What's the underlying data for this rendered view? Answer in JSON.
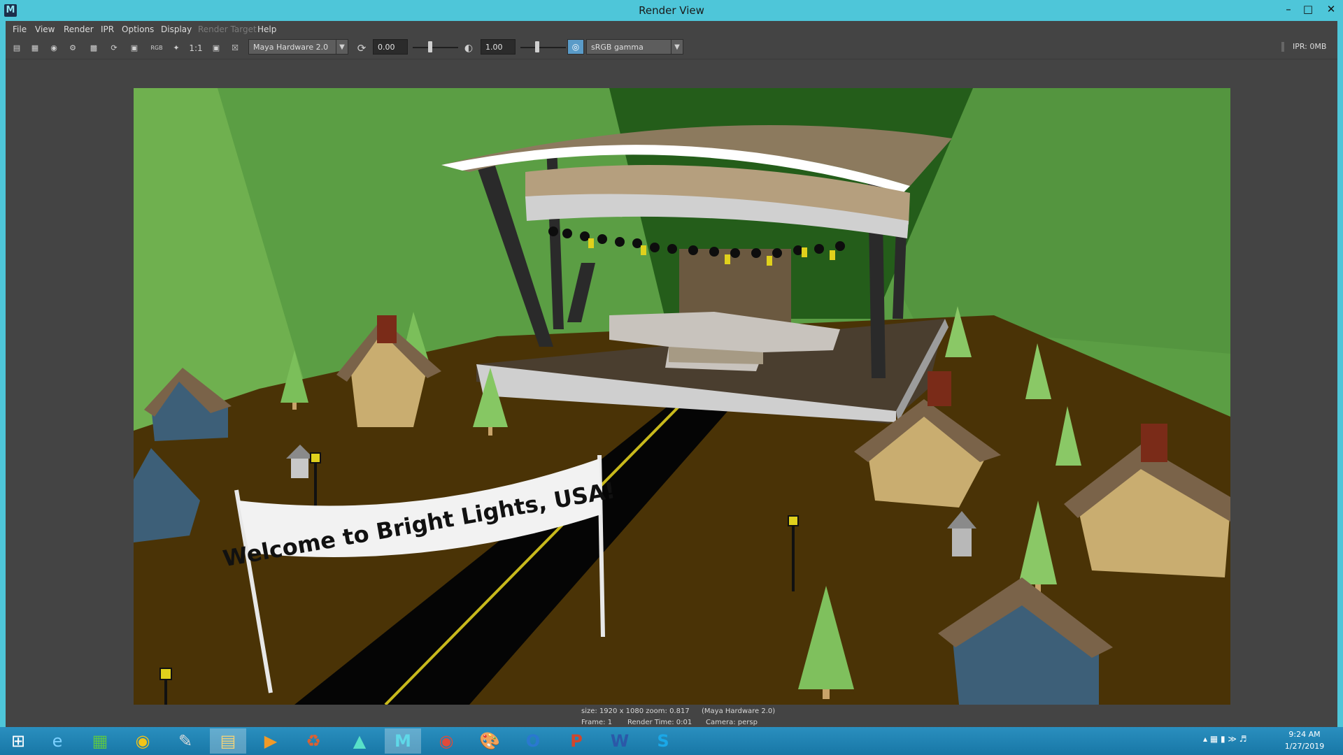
{
  "window": {
    "title": "Render View",
    "app_icon": "M"
  },
  "menu": [
    "File",
    "View",
    "Render",
    "IPR",
    "Options",
    "Display",
    "Render Target",
    "Help"
  ],
  "toolbar": {
    "ratio_label": "1:1",
    "rgb_label": "RGB",
    "renderer": "Maya Hardware 2.0",
    "exposure": "0.00",
    "gamma": "1.00",
    "colorspace": "sRGB gamma",
    "ipr_memory": "IPR: 0MB"
  },
  "scene": {
    "banner_text": "Welcome to Bright Lights, USA!"
  },
  "info": {
    "size_zoom": "size: 1920 x 1080 zoom: 0.817",
    "renderer": "(Maya Hardware 2.0)",
    "frame": "Frame: 1",
    "render_time": "Render Time: 0:01",
    "camera": "Camera: persp"
  },
  "taskbar": {
    "apps": [
      "start-icon",
      "internet-explorer-icon",
      "store-icon",
      "chrome-canary-icon",
      "notes-app-icon",
      "file-explorer-icon",
      "media-player-icon",
      "uninstaller-icon",
      "maya-launcher-icon",
      "maya-icon",
      "chrome-icon",
      "paint-icon",
      "outlook-icon",
      "powerpoint-icon",
      "word-icon",
      "skype-icon"
    ],
    "time": "9:24 AM",
    "date": "1/27/2019"
  },
  "colors": {
    "titlebar": "#4ec6d9",
    "panel": "#444444",
    "ground": "#4a3306",
    "sky": "#5a9c43"
  }
}
